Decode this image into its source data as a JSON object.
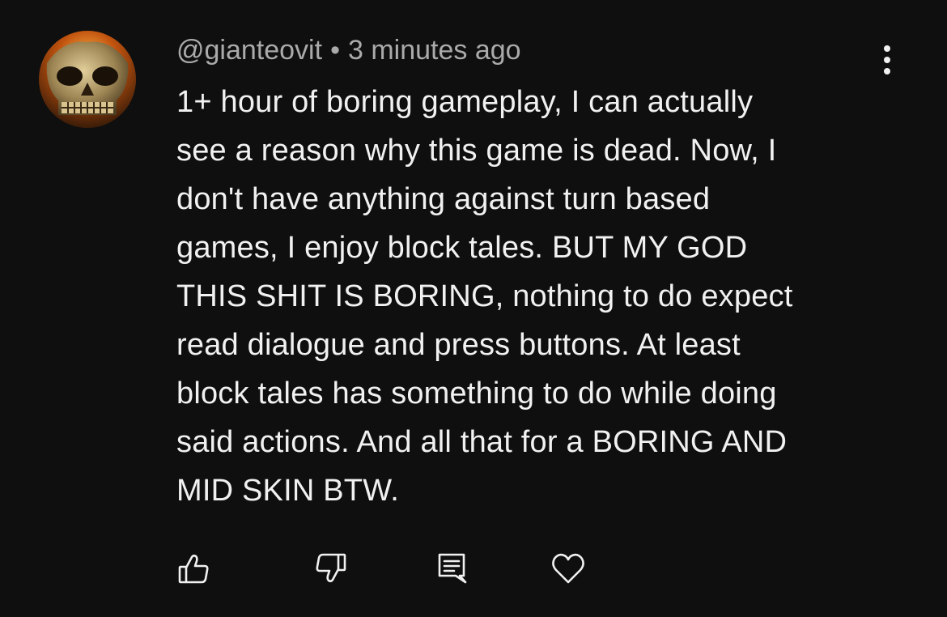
{
  "comment": {
    "author": "@gianteovit",
    "separator": "•",
    "time": "3 minutes ago",
    "lines": [
      "1+ hour of boring gameplay, I can actually",
      "see a reason why this game is dead. Now, I",
      "don't have anything against turn based",
      "games, I enjoy block tales. BUT MY GOD",
      "THIS SHIT IS BORING, nothing to do expect",
      "read dialogue and press buttons. At least",
      "block tales has something to do while doing",
      "said actions. And all that for a BORING AND",
      "MID SKIN BTW."
    ]
  },
  "icons": {
    "avatar": "skull-avatar",
    "more": "more-vertical-icon",
    "like": "thumbs-up-icon",
    "dislike": "thumbs-down-icon",
    "reply": "reply-comment-icon",
    "heart": "heart-icon"
  },
  "colors": {
    "background": "#0f0f0f",
    "text": "#f1f1f1",
    "meta": "#aaaaaa"
  }
}
